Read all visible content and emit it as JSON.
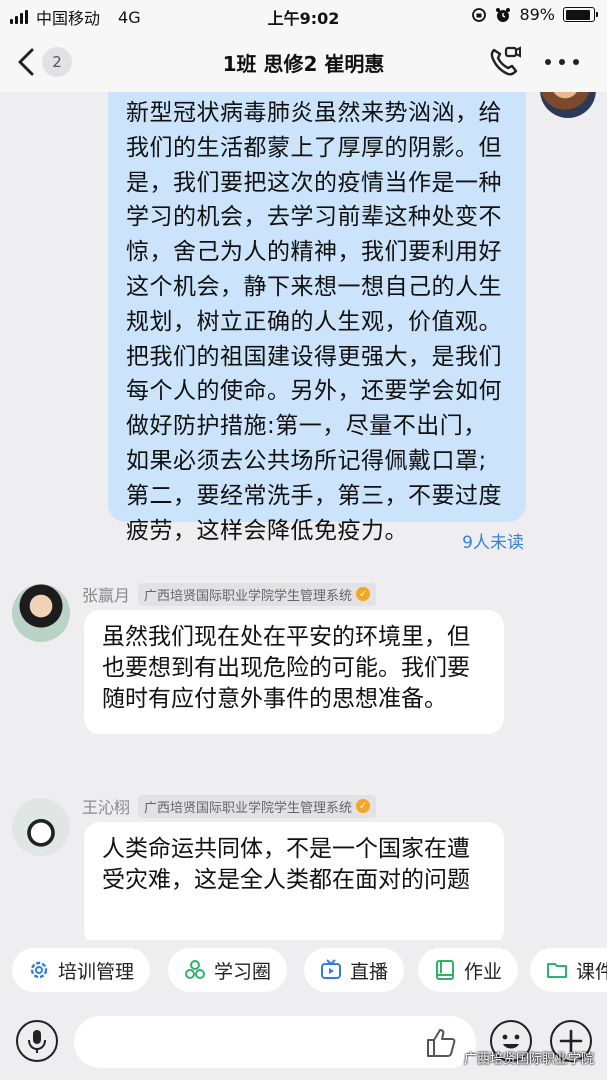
{
  "status_bar": {
    "carrier": "中国移动",
    "network": "4G",
    "time": "上午9:02",
    "battery": "89%",
    "battery_level": 0.89
  },
  "header": {
    "unread_count": "2",
    "title": "1班 思修2 崔明惠"
  },
  "my_message": {
    "text": "新型冠状病毒肺炎虽然来势汹汹，给我们的生活都蒙上了厚厚的阴影。但是，我们要把这次的疫情当作是一种学习的机会，去学习前辈这种处变不惊，舍己为人的精神，我们要利用好这个机会，静下来想一想自己的人生规划，树立正确的人生观，价值观。把我们的祖国建设得更强大，是我们每个人的使命。另外，还要学会如何做好防护措施:第一，尽量不出门，如果必须去公共场所记得佩戴口罩;第二，要经常洗手，第三，不要过度疲劳，这样会降低免疫力。",
    "read_status": "9人未读"
  },
  "messages": [
    {
      "sender": "张赢月",
      "org": "广西培贤国际职业学院学生管理系统",
      "text": "虽然我们现在处在平安的环境里，但也要想到有出现危险的可能。我们要随时有应付意外事件的思想准备。"
    },
    {
      "sender": "王沁栩",
      "org": "广西培贤国际职业学院学生管理系统",
      "text": "人类命运共同体，不是一个国家在遭受灾难，这是全人类都在面对的问题"
    }
  ],
  "quick_apps": [
    {
      "label": "培训管理",
      "icon": "gear-icon",
      "color": "#2f7fe0"
    },
    {
      "label": "学习圈",
      "icon": "circle-group-icon",
      "color": "#2fb36a"
    },
    {
      "label": "直播",
      "icon": "tv-icon",
      "color": "#2f7fe0"
    },
    {
      "label": "作业",
      "icon": "book-icon",
      "color": "#2fb36a"
    },
    {
      "label": "课件",
      "icon": "folder-icon",
      "color": "#2fb36a"
    }
  ],
  "watermark": "广西培贤国际职业学院"
}
